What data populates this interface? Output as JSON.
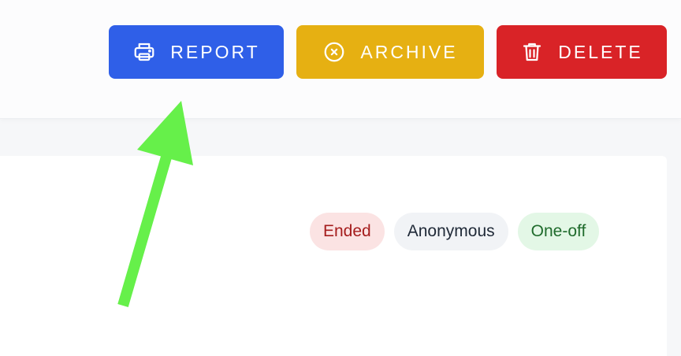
{
  "toolbar": {
    "report_label": "REPORT",
    "archive_label": "ARCHIVE",
    "delete_label": "DELETE",
    "colors": {
      "report": "#2f5fe8",
      "archive": "#e6b012",
      "delete": "#d92327"
    },
    "icons": {
      "report": "printer-icon",
      "archive": "circle-x-icon",
      "delete": "trash-icon"
    }
  },
  "tags": [
    {
      "label": "Ended",
      "color": "#a51c1c",
      "bg": "#fbe3e3"
    },
    {
      "label": "Anonymous",
      "color": "#1f2937",
      "bg": "#f1f3f6"
    },
    {
      "label": "One-off",
      "color": "#1f6b2c",
      "bg": "#e3f7e6"
    }
  ],
  "annotation": {
    "arrow_color": "#66f04a",
    "points_to": "report-button"
  }
}
